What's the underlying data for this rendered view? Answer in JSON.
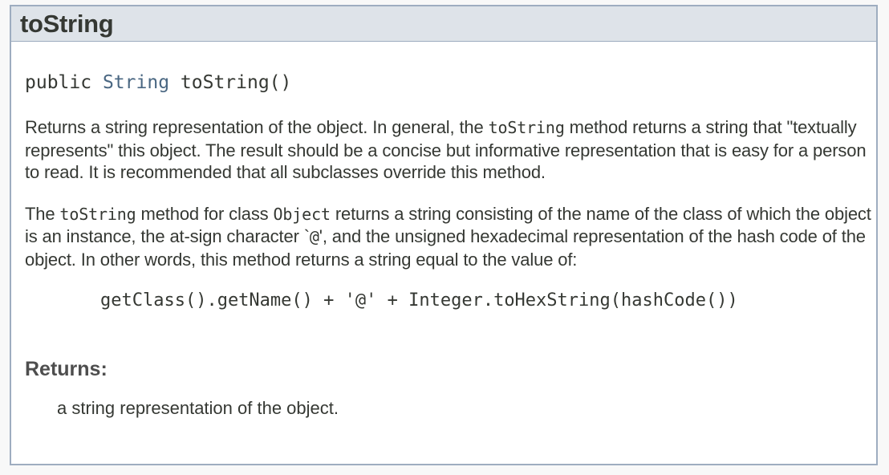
{
  "method": {
    "name": "toString",
    "signature": {
      "modifier": "public",
      "return_type": "String",
      "name_params": "toString()"
    },
    "description": {
      "p1": {
        "a": "Returns a string representation of the object. In general, the ",
        "code": "toString",
        "b": " method returns a string that \"textually represents\" this object. The result should be a concise but informative representation that is easy for a person to read. It is recommended that all subclasses override this method."
      },
      "p2": {
        "a": "The ",
        "code1": "toString",
        "b": " method for class ",
        "code2": "Object",
        "c": " returns a string consisting of the name of the class of which the object is an instance, the at-sign character `",
        "code3": "@",
        "d": "', and the unsigned hexadecimal representation of the hash code of the object. In other words, this method returns a string equal to the value of:"
      },
      "code_example": "getClass().getName() + '@' + Integer.toHexString(hashCode())"
    },
    "returns": {
      "label": "Returns:",
      "value": "a string representation of the object."
    }
  },
  "colors": {
    "header_bg": "#dee3e9",
    "border": "#9eadc0",
    "type_link": "#4a6782",
    "text": "#353833"
  }
}
